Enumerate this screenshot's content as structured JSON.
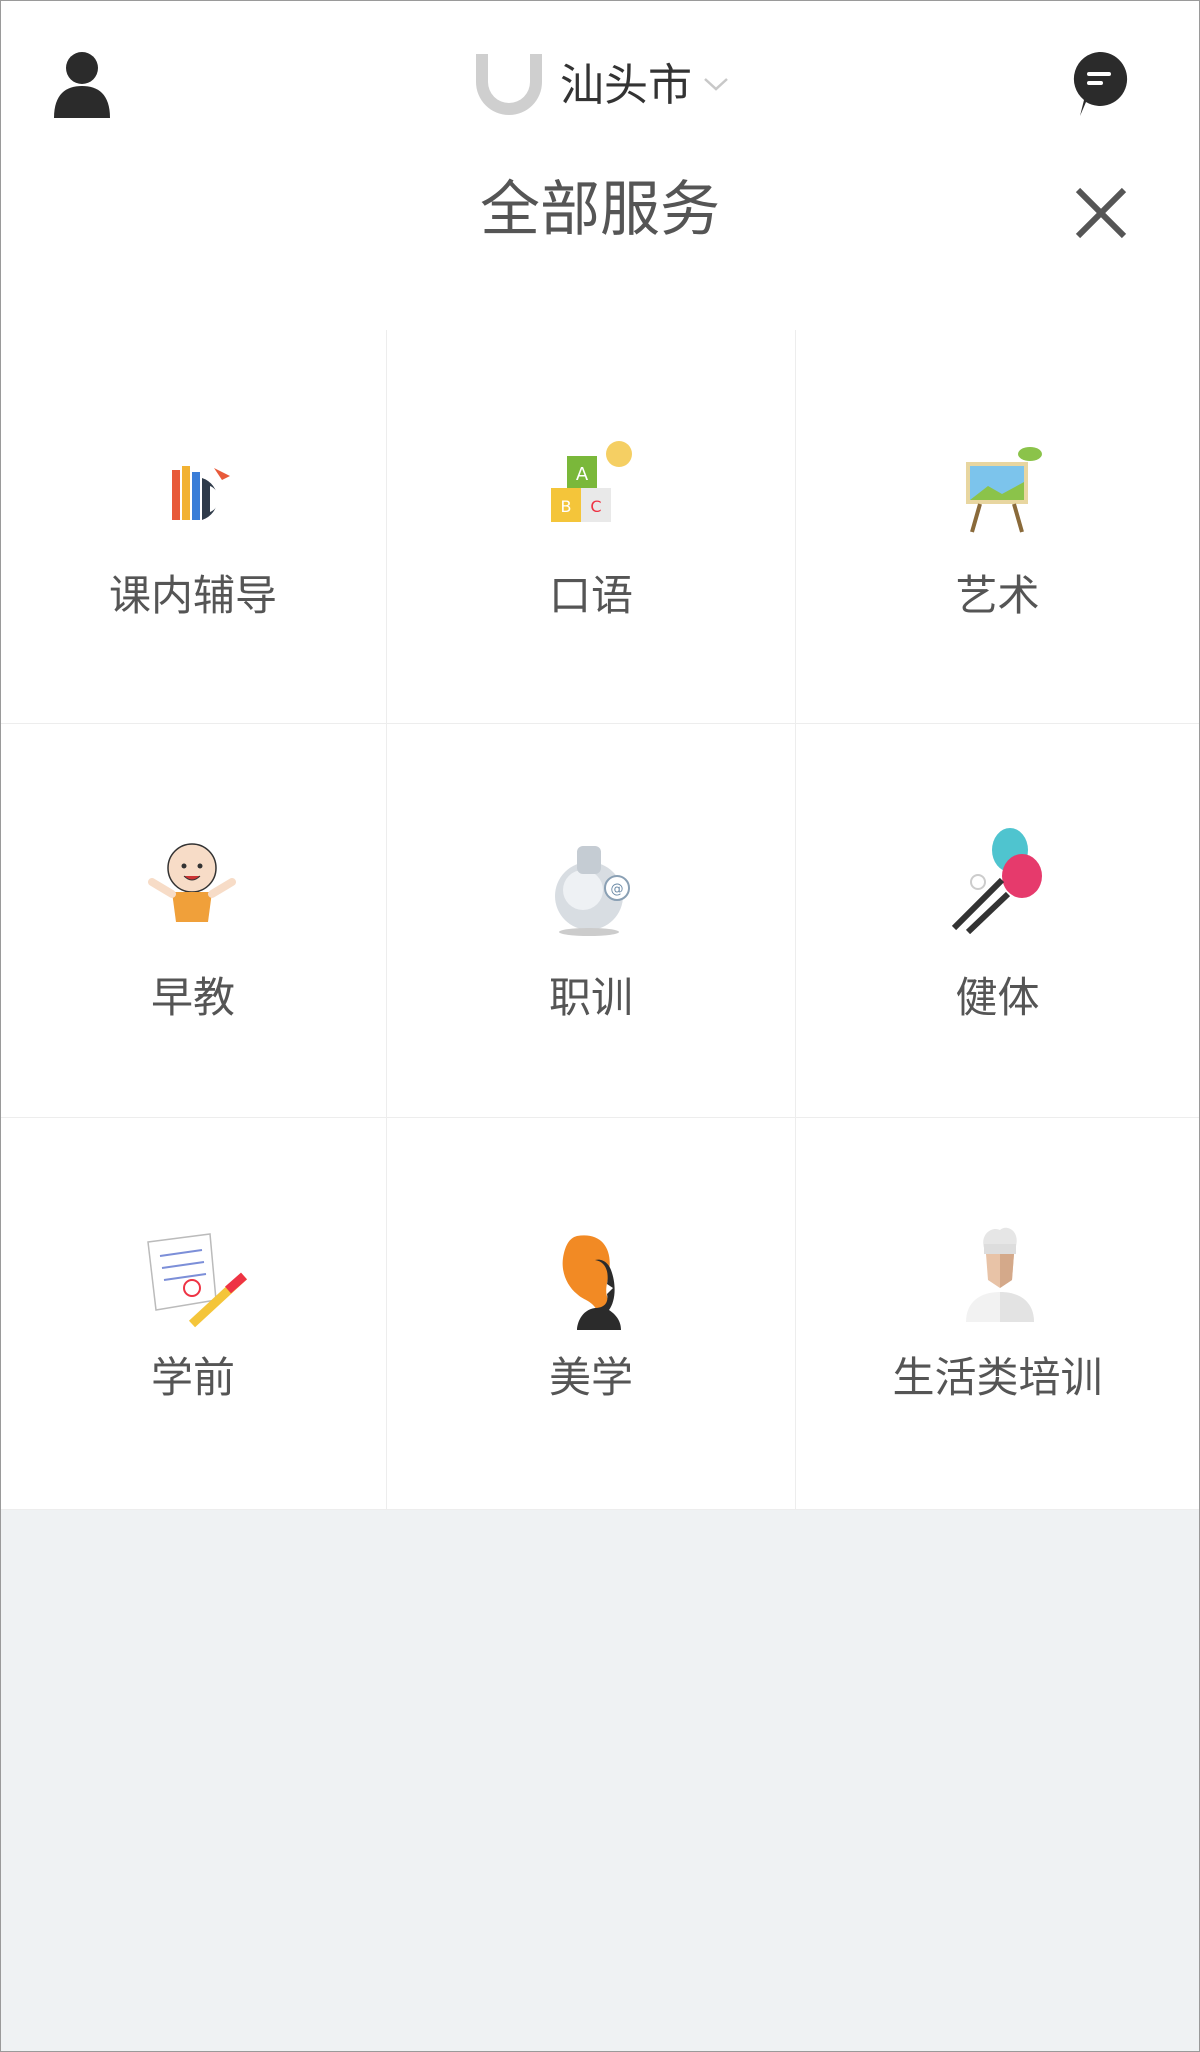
{
  "header": {
    "city": "汕头市",
    "title": "全部服务"
  },
  "services": [
    {
      "label": "课内辅导",
      "icon": "stationery-icon"
    },
    {
      "label": "口语",
      "icon": "abc-blocks-icon"
    },
    {
      "label": "艺术",
      "icon": "easel-icon"
    },
    {
      "label": "早教",
      "icon": "baby-icon"
    },
    {
      "label": "职训",
      "icon": "globe-icon"
    },
    {
      "label": "健体",
      "icon": "badminton-icon"
    },
    {
      "label": "学前",
      "icon": "notepad-pencil-icon"
    },
    {
      "label": "美学",
      "icon": "woman-silhouette-icon"
    },
    {
      "label": "生活类培训",
      "icon": "chef-icon"
    }
  ]
}
